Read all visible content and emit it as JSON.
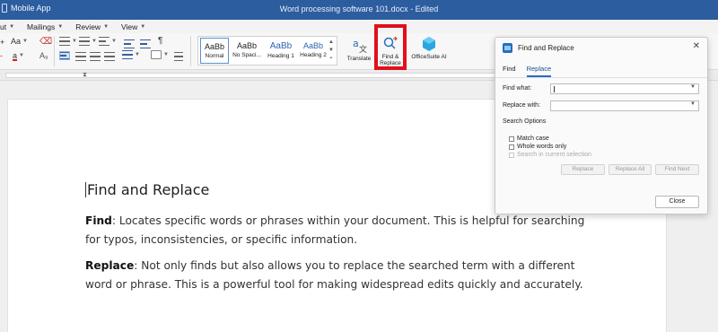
{
  "titlebar": {
    "app_name": "Mobile App",
    "doc_title": "Word processing software 101.docx - Edited"
  },
  "menu": [
    {
      "label": "ut"
    },
    {
      "label": "Mailings"
    },
    {
      "label": "Review"
    },
    {
      "label": "View"
    }
  ],
  "ribbon": {
    "font_size_label": "Aa",
    "font_color_label": "a",
    "styles": [
      {
        "sample": "AaBb",
        "label": "Normal"
      },
      {
        "sample": "AaBb",
        "label": "No Spaci..."
      },
      {
        "sample": "AaBb",
        "label": "Heading 1"
      },
      {
        "sample": "AaBb",
        "label": "Heading 2"
      }
    ],
    "translate_label": "Translate",
    "find_replace_label": "Find &\nReplace",
    "find_replace_line1": "Find &",
    "find_replace_line2": "Replace",
    "officesuite_ai_label": "OfficeSuite AI",
    "pilcrow": "¶"
  },
  "document": {
    "heading": "Find and Replace",
    "para1_term": "Find",
    "para1_text": ": Locates specific words or phrases within your document. This is helpful for searching for typos, inconsistencies, or specific information.",
    "para2_term": "Replace",
    "para2_text": ": Not only finds but also allows you to replace the searched term with a different word or phrase. This is a powerful tool for making widespread edits quickly and accurately."
  },
  "dialog": {
    "title": "Find and Replace",
    "tabs": [
      "Find",
      "Replace"
    ],
    "find_what_label": "Find what:",
    "find_what_value": "",
    "replace_with_label": "Replace with:",
    "replace_with_value": "",
    "search_options_label": "Search Options",
    "options": [
      {
        "label": "Match case",
        "checked": false,
        "enabled": true
      },
      {
        "label": "Whole words only",
        "checked": false,
        "enabled": true
      },
      {
        "label": "Search in current selection",
        "checked": false,
        "enabled": false
      }
    ],
    "replace_button": "Replace",
    "replace_all_button": "Replace All",
    "find_next_button": "Find Next",
    "close_button": "Close"
  },
  "colors": {
    "titlebar": "#2c5d9f",
    "highlight": "#e0101c",
    "accent": "#2a6cc0"
  }
}
